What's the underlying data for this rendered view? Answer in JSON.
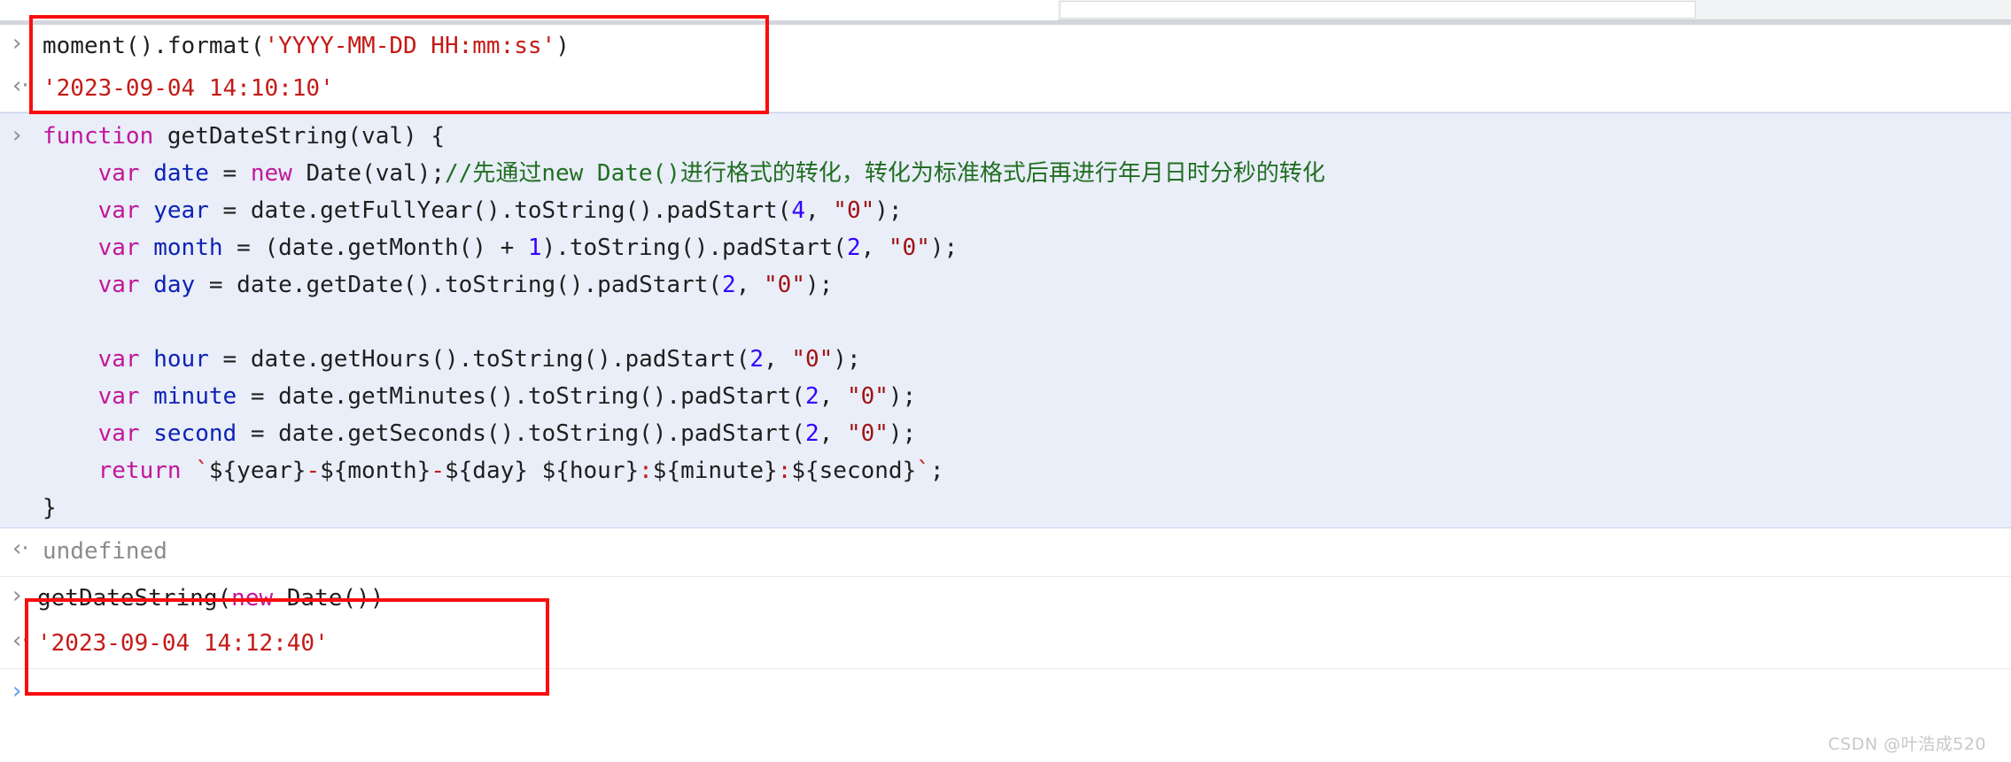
{
  "app": {
    "name": "Chrome DevTools Console",
    "watermark": "CSDN @叶浩成520"
  },
  "toolbar": {
    "visible": true
  },
  "prompt_glyphs": {
    "input_arrow": "›",
    "output_arrow": "‹·"
  },
  "colors": {
    "code_block_background": "#e9eef9",
    "code_block_border": "#c6d4ef",
    "annotation_red": "#fb0d0d",
    "keyword": "#c2169b",
    "identifier": "#0d22b5",
    "string": "#c41a16",
    "string_dark": "#a11212",
    "number": "#3300ff",
    "comment": "#216e21",
    "result": "#c41a16",
    "undefined": "#8b8b8b",
    "prompt_gray": "#8d8d8d",
    "prompt_blue": "#5a9cf8"
  },
  "console": {
    "entries": [
      {
        "kind": "input",
        "name": "moment-format-call",
        "tokens": [
          {
            "t": "moment()",
            "c": "tok-plain"
          },
          {
            "t": ".",
            "c": "tok-plain"
          },
          {
            "t": "format",
            "c": "tok-plain"
          },
          {
            "t": "(",
            "c": "tok-plain"
          },
          {
            "t": "'YYYY-MM-DD HH:mm:ss'",
            "c": "tok-str"
          },
          {
            "t": ")",
            "c": "tok-plain"
          }
        ],
        "plain": "moment().format('YYYY-MM-DD HH:mm:ss')"
      },
      {
        "kind": "output",
        "name": "moment-format-result",
        "tokens": [
          {
            "t": "'2023-09-04 14:10:10'",
            "c": "tok-result"
          }
        ],
        "plain": "'2023-09-04 14:10:10'"
      },
      {
        "kind": "input-block",
        "name": "getdatestring-function-definition",
        "lines": [
          [
            {
              "t": "function ",
              "c": "tok-kw"
            },
            {
              "t": "getDateString",
              "c": "tok-plain"
            },
            {
              "t": "(",
              "c": "tok-plain"
            },
            {
              "t": "val",
              "c": "tok-plain"
            },
            {
              "t": ") {",
              "c": "tok-plain"
            }
          ],
          [
            {
              "t": "    ",
              "c": "tok-plain"
            },
            {
              "t": "var ",
              "c": "tok-kw"
            },
            {
              "t": "date",
              "c": "tok-ident"
            },
            {
              "t": " = ",
              "c": "tok-plain"
            },
            {
              "t": "new ",
              "c": "tok-kw"
            },
            {
              "t": "Date(val);",
              "c": "tok-plain"
            },
            {
              "t": "//先通过new Date()进行格式的转化，转化为标准格式后再进行年月日时分秒的转化",
              "c": "tok-comment"
            }
          ],
          [
            {
              "t": "    ",
              "c": "tok-plain"
            },
            {
              "t": "var ",
              "c": "tok-kw"
            },
            {
              "t": "year",
              "c": "tok-ident"
            },
            {
              "t": " = date.getFullYear().toString().padStart(",
              "c": "tok-plain"
            },
            {
              "t": "4",
              "c": "tok-num"
            },
            {
              "t": ", ",
              "c": "tok-plain"
            },
            {
              "t": "\"0\"",
              "c": "tok-strdark"
            },
            {
              "t": ");",
              "c": "tok-plain"
            }
          ],
          [
            {
              "t": "    ",
              "c": "tok-plain"
            },
            {
              "t": "var ",
              "c": "tok-kw"
            },
            {
              "t": "month",
              "c": "tok-ident"
            },
            {
              "t": " = (date.getMonth() + ",
              "c": "tok-plain"
            },
            {
              "t": "1",
              "c": "tok-num"
            },
            {
              "t": ").toString().padStart(",
              "c": "tok-plain"
            },
            {
              "t": "2",
              "c": "tok-num"
            },
            {
              "t": ", ",
              "c": "tok-plain"
            },
            {
              "t": "\"0\"",
              "c": "tok-strdark"
            },
            {
              "t": ");",
              "c": "tok-plain"
            }
          ],
          [
            {
              "t": "    ",
              "c": "tok-plain"
            },
            {
              "t": "var ",
              "c": "tok-kw"
            },
            {
              "t": "day",
              "c": "tok-ident"
            },
            {
              "t": " = date.getDate().toString().padStart(",
              "c": "tok-plain"
            },
            {
              "t": "2",
              "c": "tok-num"
            },
            {
              "t": ", ",
              "c": "tok-plain"
            },
            {
              "t": "\"0\"",
              "c": "tok-strdark"
            },
            {
              "t": ");",
              "c": "tok-plain"
            }
          ],
          [
            {
              "t": "",
              "c": "tok-plain"
            }
          ],
          [
            {
              "t": "    ",
              "c": "tok-plain"
            },
            {
              "t": "var ",
              "c": "tok-kw"
            },
            {
              "t": "hour",
              "c": "tok-ident"
            },
            {
              "t": " = date.getHours().toString().padStart(",
              "c": "tok-plain"
            },
            {
              "t": "2",
              "c": "tok-num"
            },
            {
              "t": ", ",
              "c": "tok-plain"
            },
            {
              "t": "\"0\"",
              "c": "tok-strdark"
            },
            {
              "t": ");",
              "c": "tok-plain"
            }
          ],
          [
            {
              "t": "    ",
              "c": "tok-plain"
            },
            {
              "t": "var ",
              "c": "tok-kw"
            },
            {
              "t": "minute",
              "c": "tok-ident"
            },
            {
              "t": " = date.getMinutes().toString().padStart(",
              "c": "tok-plain"
            },
            {
              "t": "2",
              "c": "tok-num"
            },
            {
              "t": ", ",
              "c": "tok-plain"
            },
            {
              "t": "\"0\"",
              "c": "tok-strdark"
            },
            {
              "t": ");",
              "c": "tok-plain"
            }
          ],
          [
            {
              "t": "    ",
              "c": "tok-plain"
            },
            {
              "t": "var ",
              "c": "tok-kw"
            },
            {
              "t": "second",
              "c": "tok-ident"
            },
            {
              "t": " = date.getSeconds().toString().padStart(",
              "c": "tok-plain"
            },
            {
              "t": "2",
              "c": "tok-num"
            },
            {
              "t": ", ",
              "c": "tok-plain"
            },
            {
              "t": "\"0\"",
              "c": "tok-strdark"
            },
            {
              "t": ");",
              "c": "tok-plain"
            }
          ],
          [
            {
              "t": "    ",
              "c": "tok-plain"
            },
            {
              "t": "return ",
              "c": "tok-kw"
            },
            {
              "t": "`",
              "c": "tok-result"
            },
            {
              "t": "${year}",
              "c": "tok-plain"
            },
            {
              "t": "-",
              "c": "tok-result"
            },
            {
              "t": "${month}",
              "c": "tok-plain"
            },
            {
              "t": "-",
              "c": "tok-result"
            },
            {
              "t": "${day}",
              "c": "tok-plain"
            },
            {
              "t": " ",
              "c": "tok-result"
            },
            {
              "t": "${hour}",
              "c": "tok-plain"
            },
            {
              "t": ":",
              "c": "tok-result"
            },
            {
              "t": "${minute}",
              "c": "tok-plain"
            },
            {
              "t": ":",
              "c": "tok-result"
            },
            {
              "t": "${second}",
              "c": "tok-plain"
            },
            {
              "t": "`",
              "c": "tok-result"
            },
            {
              "t": ";",
              "c": "tok-plain"
            }
          ],
          [
            {
              "t": "}",
              "c": "tok-plain"
            }
          ]
        ]
      },
      {
        "kind": "output",
        "name": "function-definition-result",
        "tokens": [
          {
            "t": "undefined",
            "c": "tok-undef"
          }
        ],
        "plain": "undefined"
      },
      {
        "kind": "input",
        "name": "getdatestring-call",
        "tokens": [
          {
            "t": "getDateString",
            "c": "tok-plain"
          },
          {
            "t": "(",
            "c": "tok-plain"
          },
          {
            "t": "new ",
            "c": "tok-kw"
          },
          {
            "t": "Date())",
            "c": "tok-plain"
          }
        ],
        "plain": "getDateString(new Date())"
      },
      {
        "kind": "output",
        "name": "getdatestring-result",
        "tokens": [
          {
            "t": "'2023-09-04 14:12:40'",
            "c": "tok-result"
          }
        ],
        "plain": "'2023-09-04 14:12:40'"
      }
    ]
  },
  "annotations": [
    {
      "name": "annotation-box-moment",
      "label": ""
    },
    {
      "name": "annotation-box-getdatestring",
      "label": ""
    }
  ]
}
